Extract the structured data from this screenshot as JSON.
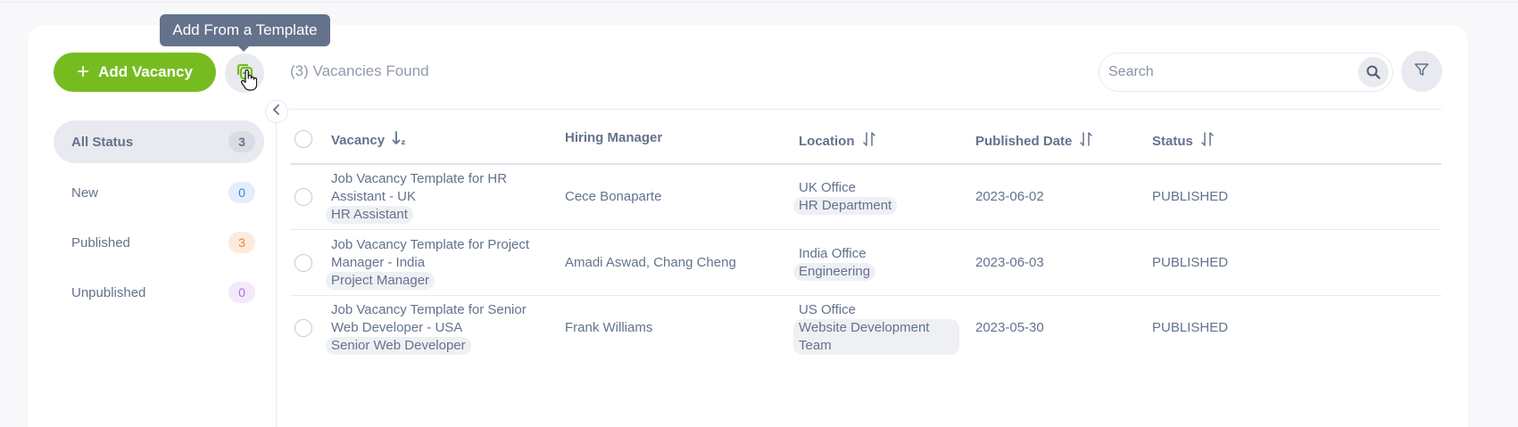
{
  "toolbar": {
    "add_vacancy_label": "Add Vacancy",
    "template_tooltip": "Add From a Template",
    "found_text": "(3) Vacancies Found",
    "search_placeholder": "Search"
  },
  "status_filters": [
    {
      "label": "All Status",
      "count": "3",
      "count_color": "#64728c",
      "count_bg": "#d9dce3"
    },
    {
      "label": "New",
      "count": "0",
      "count_color": "#3f7fe0",
      "count_bg": "#e4edfb"
    },
    {
      "label": "Published",
      "count": "3",
      "count_color": "#e8853b",
      "count_bg": "#fcebdd"
    },
    {
      "label": "Unpublished",
      "count": "0",
      "count_color": "#b36be0",
      "count_bg": "#f4e8fb"
    }
  ],
  "table": {
    "headers": [
      "Vacancy",
      "Hiring Manager",
      "Location",
      "Published Date",
      "Status"
    ],
    "rows": [
      {
        "title": "Job Vacancy Template for HR Assistant - UK",
        "job_title": "HR Assistant",
        "hiring_manager": "Cece Bonaparte",
        "location": "UK Office",
        "department": "HR Department",
        "published_date": "2023-06-02",
        "status": "PUBLISHED"
      },
      {
        "title": "Job Vacancy Template for Project Manager - India",
        "job_title": "Project Manager",
        "hiring_manager": "Amadi Aswad, Chang Cheng",
        "location": "India Office",
        "department": "Engineering",
        "published_date": "2023-06-03",
        "status": "PUBLISHED"
      },
      {
        "title": "Job Vacancy Template for Senior Web Developer - USA",
        "job_title": "Senior Web Developer",
        "hiring_manager": "Frank Williams",
        "location": "US Office",
        "department": "Website Development Team",
        "published_date": "2023-05-30",
        "status": "PUBLISHED"
      }
    ]
  },
  "colors": {
    "accent": "#76bc21",
    "text": "#64728c",
    "muted_bg": "#e8eaef"
  }
}
